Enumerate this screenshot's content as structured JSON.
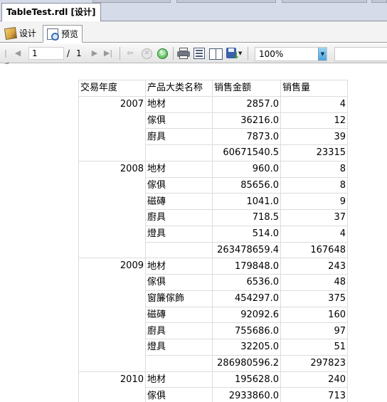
{
  "document_tab": {
    "title": "TableTest.rdl [设计]"
  },
  "view_tabs": [
    {
      "label": "设计",
      "icon": "design-icon",
      "active": false
    },
    {
      "label": "预览",
      "icon": "preview-icon",
      "active": true
    }
  ],
  "toolbar": {
    "current_page": "1",
    "page_of": "/",
    "page_total": "1",
    "zoom": "100%",
    "icons": [
      "first-page-icon",
      "previous-page-icon",
      "next-page-icon",
      "last-page-icon",
      "back-icon",
      "stop-icon",
      "refresh-icon",
      "print-icon",
      "print-layout-icon",
      "page-setup-icon",
      "export-icon"
    ]
  },
  "report": {
    "headers": [
      "交易年度",
      "产品大类名称",
      "销售金额",
      "销售量"
    ],
    "groups": [
      {
        "year": "2007",
        "rows": [
          {
            "category": "地材",
            "amount": "2857.0",
            "qty": "4"
          },
          {
            "category": "傢俱",
            "amount": "36216.0",
            "qty": "12"
          },
          {
            "category": "廚具",
            "amount": "7873.0",
            "qty": "39"
          },
          {
            "category": "",
            "amount": "60671540.5",
            "qty": "23315"
          }
        ]
      },
      {
        "year": "2008",
        "rows": [
          {
            "category": "地材",
            "amount": "960.0",
            "qty": "8"
          },
          {
            "category": "傢俱",
            "amount": "85656.0",
            "qty": "8"
          },
          {
            "category": "磁磚",
            "amount": "1041.0",
            "qty": "9"
          },
          {
            "category": "廚具",
            "amount": "718.5",
            "qty": "37"
          },
          {
            "category": "燈具",
            "amount": "514.0",
            "qty": "4"
          },
          {
            "category": "",
            "amount": "263478659.4",
            "qty": "167648"
          }
        ]
      },
      {
        "year": "2009",
        "rows": [
          {
            "category": "地材",
            "amount": "179848.0",
            "qty": "243"
          },
          {
            "category": "傢俱",
            "amount": "6536.0",
            "qty": "48"
          },
          {
            "category": "窗簾傢飾",
            "amount": "454297.0",
            "qty": "375"
          },
          {
            "category": "磁磚",
            "amount": "92092.6",
            "qty": "160"
          },
          {
            "category": "廚具",
            "amount": "755686.0",
            "qty": "97"
          },
          {
            "category": "燈具",
            "amount": "32205.0",
            "qty": "51"
          },
          {
            "category": "",
            "amount": "286980596.2",
            "qty": "297823"
          }
        ]
      },
      {
        "year": "2010",
        "rows": [
          {
            "category": "地材",
            "amount": "195628.0",
            "qty": "240"
          },
          {
            "category": "傢俱",
            "amount": "2933860.0",
            "qty": "713"
          }
        ]
      }
    ]
  }
}
